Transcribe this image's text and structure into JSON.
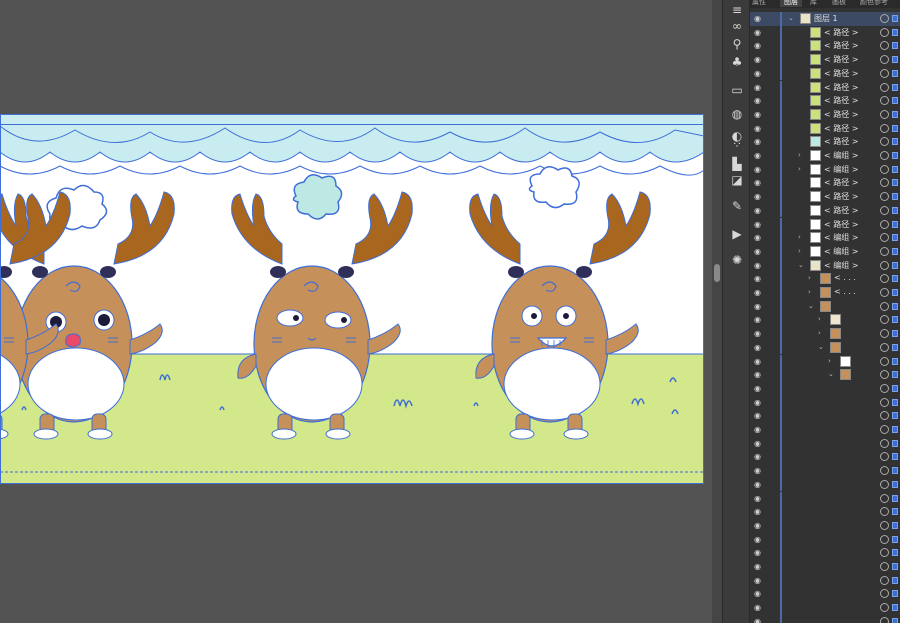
{
  "panel": {
    "tabs": [
      "属性",
      "图层",
      "库",
      "画板",
      "颜色参考"
    ],
    "active_tab": 1
  },
  "layers": [
    {
      "indent": 0,
      "chevron": "v",
      "label": "图层 1",
      "thumb": "deer-strip"
    },
    {
      "indent": 1,
      "chevron": "",
      "label": "< 路径 >",
      "thumb": "green"
    },
    {
      "indent": 1,
      "chevron": "",
      "label": "< 路径 >",
      "thumb": "green"
    },
    {
      "indent": 1,
      "chevron": "",
      "label": "< 路径 >",
      "thumb": "green"
    },
    {
      "indent": 1,
      "chevron": "",
      "label": "< 路径 >",
      "thumb": "green"
    },
    {
      "indent": 1,
      "chevron": "",
      "label": "< 路径 >",
      "thumb": "green"
    },
    {
      "indent": 1,
      "chevron": "",
      "label": "< 路径 >",
      "thumb": "green"
    },
    {
      "indent": 1,
      "chevron": "",
      "label": "< 路径 >",
      "thumb": "green"
    },
    {
      "indent": 1,
      "chevron": "",
      "label": "< 路径 >",
      "thumb": "green"
    },
    {
      "indent": 1,
      "chevron": "",
      "label": "< 路径 >",
      "thumb": "cyan"
    },
    {
      "indent": 1,
      "chevron": ">",
      "label": "< 编组 >",
      "thumb": "white"
    },
    {
      "indent": 1,
      "chevron": ">",
      "label": "< 编组 >",
      "thumb": "white"
    },
    {
      "indent": 1,
      "chevron": "",
      "label": "< 路径 >",
      "thumb": "white"
    },
    {
      "indent": 1,
      "chevron": "",
      "label": "< 路径 >",
      "thumb": "white"
    },
    {
      "indent": 1,
      "chevron": "",
      "label": "< 路径 >",
      "thumb": "white"
    },
    {
      "indent": 1,
      "chevron": "",
      "label": "< 路径 >",
      "thumb": "white"
    },
    {
      "indent": 1,
      "chevron": ">",
      "label": "< 编组 >",
      "thumb": "white"
    },
    {
      "indent": 1,
      "chevron": ">",
      "label": "< 编组 >",
      "thumb": "white"
    },
    {
      "indent": 1,
      "chevron": "v",
      "label": "< 编组 >",
      "thumb": "deer-strip"
    },
    {
      "indent": 2,
      "chevron": ">",
      "label": "< . . .",
      "thumb": "deer"
    },
    {
      "indent": 2,
      "chevron": ">",
      "label": "< . . .",
      "thumb": "deer"
    },
    {
      "indent": 2,
      "chevron": "v",
      "label": "",
      "thumb": "deer"
    },
    {
      "indent": 3,
      "chevron": ">",
      "label": "",
      "thumb": "face"
    },
    {
      "indent": 3,
      "chevron": ">",
      "label": "",
      "thumb": "deer"
    },
    {
      "indent": 3,
      "chevron": "v",
      "label": "",
      "thumb": "deer"
    },
    {
      "indent": 4,
      "chevron": ">",
      "label": "",
      "thumb": "white"
    },
    {
      "indent": 4,
      "chevron": "v",
      "label": "",
      "thumb": "deer"
    },
    {
      "indent": 5,
      "chevron": "",
      "label": "",
      "thumb": ""
    },
    {
      "indent": 5,
      "chevron": "",
      "label": "",
      "thumb": ""
    },
    {
      "indent": 5,
      "chevron": "",
      "label": "",
      "thumb": ""
    },
    {
      "indent": 5,
      "chevron": "",
      "label": "",
      "thumb": ""
    },
    {
      "indent": 5,
      "chevron": "",
      "label": "",
      "thumb": ""
    },
    {
      "indent": 5,
      "chevron": "",
      "label": "",
      "thumb": ""
    },
    {
      "indent": 5,
      "chevron": "",
      "label": "",
      "thumb": ""
    },
    {
      "indent": 5,
      "chevron": "",
      "label": "",
      "thumb": ""
    },
    {
      "indent": 5,
      "chevron": "",
      "label": "",
      "thumb": ""
    },
    {
      "indent": 5,
      "chevron": "",
      "label": "",
      "thumb": ""
    },
    {
      "indent": 5,
      "chevron": "",
      "label": "",
      "thumb": ""
    },
    {
      "indent": 5,
      "chevron": "",
      "label": "",
      "thumb": ""
    },
    {
      "indent": 5,
      "chevron": "",
      "label": "",
      "thumb": ""
    },
    {
      "indent": 5,
      "chevron": "",
      "label": "",
      "thumb": ""
    },
    {
      "indent": 5,
      "chevron": "",
      "label": "",
      "thumb": ""
    },
    {
      "indent": 5,
      "chevron": "",
      "label": "",
      "thumb": ""
    },
    {
      "indent": 5,
      "chevron": "",
      "label": "",
      "thumb": ""
    },
    {
      "indent": 5,
      "chevron": "",
      "label": "",
      "thumb": ""
    }
  ],
  "tools": [
    {
      "name": "menu-icon",
      "glyph": "≡"
    },
    {
      "name": "link-icon",
      "glyph": "∞"
    },
    {
      "name": "puppet-icon",
      "glyph": "⚲"
    },
    {
      "name": "club-icon",
      "glyph": "♣"
    },
    {
      "name": "gradient-icon",
      "glyph": "▭"
    },
    {
      "name": "stroke-icon",
      "glyph": "◍"
    },
    {
      "name": "transparency-icon",
      "glyph": "◐"
    },
    {
      "name": "grid-icon",
      "glyph": "⁘"
    },
    {
      "name": "align-icon",
      "glyph": "▙"
    },
    {
      "name": "pathfinder-icon",
      "glyph": "◪"
    },
    {
      "name": "brush-icon",
      "glyph": "✎"
    },
    {
      "name": "play-icon",
      "glyph": "▶"
    },
    {
      "name": "sun-icon",
      "glyph": "✺"
    }
  ],
  "colors": {
    "sky": "#c8ecf0",
    "white": "#ffffff",
    "grass": "#d2e88a",
    "deer_body": "#c6905a",
    "antler": "#a9661e",
    "cloud": "#bde8e4",
    "selection": "#3e6ed8"
  }
}
